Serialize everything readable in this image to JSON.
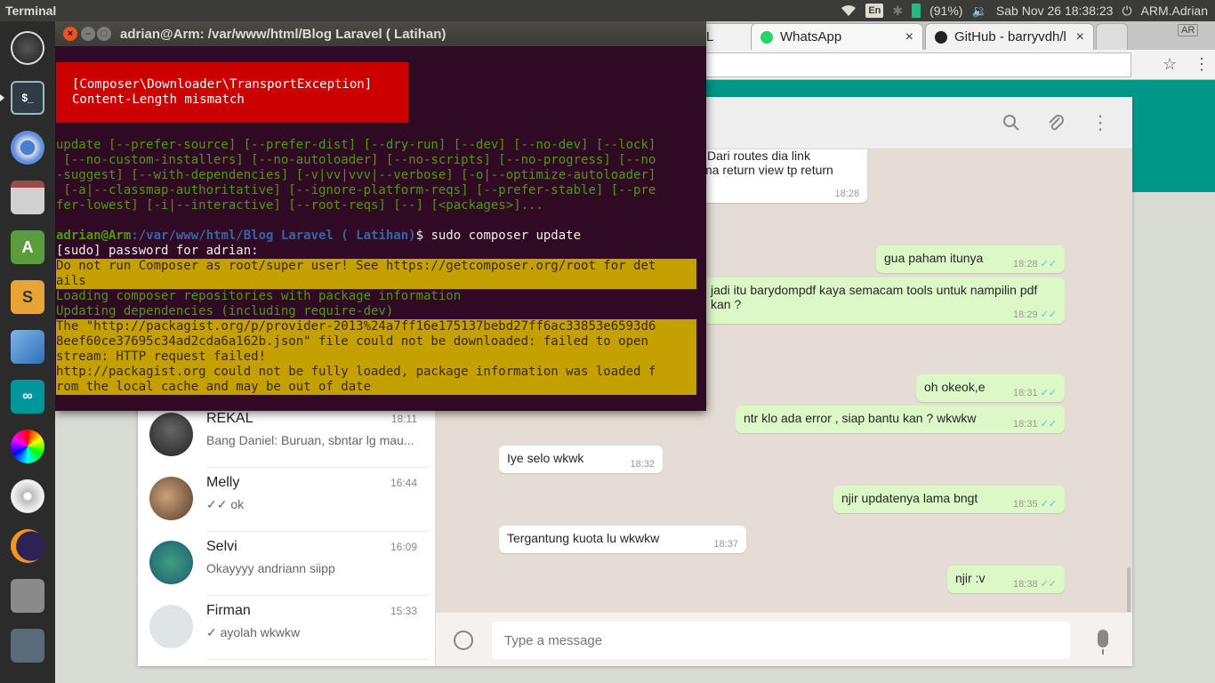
{
  "top_panel": {
    "app_name": "Terminal",
    "battery": "(91%)",
    "keyboard_layout": "En",
    "datetime": "Sab Nov 26 18:38:23",
    "user": "ARM.Adrian"
  },
  "launcher": {
    "items": [
      "ubuntu-dash",
      "terminal",
      "chromium",
      "files",
      "android-studio",
      "sublime-text",
      "virtualbox",
      "arduino",
      "color-picker",
      "disc-burner",
      "eclipse",
      "disk",
      "trash"
    ]
  },
  "browser": {
    "tabs": [
      {
        "label": "RPL",
        "close": "×"
      },
      {
        "label": "WhatsApp",
        "close": "×"
      },
      {
        "label": "GitHub - barryvdh/l",
        "close": "×"
      }
    ],
    "ar_badge": "AR"
  },
  "whatsapp": {
    "chats": [
      {
        "name": "REKAL",
        "time": "18:11",
        "preview": "Bang Daniel: Buruan, sbntar lg mau..."
      },
      {
        "name": "Melly",
        "time": "16:44",
        "preview": "✓✓ ok"
      },
      {
        "name": "Selvi",
        "time": "16:09",
        "preview": "Okayyyy andriann siipp"
      },
      {
        "name": "Firman",
        "time": "15:33",
        "preview": "✓ ayolah wkwkw"
      }
    ],
    "messages": [
      {
        "dir": "in",
        "line1": "Dari routes dia link",
        "line2": "ma return view tp return",
        "time": "18:28"
      },
      {
        "dir": "out",
        "text": "gua paham itunya",
        "time": "18:28",
        "ticks": "✓✓"
      },
      {
        "dir": "out",
        "line1": "jadi itu barydompdf kaya semacam tools untuk nampilin pdf",
        "line2": "kan ?",
        "time": "18:29",
        "ticks": "✓✓"
      },
      {
        "dir": "out",
        "text": "oh okeok,e",
        "time": "18:31",
        "ticks": "✓✓"
      },
      {
        "dir": "out",
        "text": "ntr klo ada error , siap bantu kan ? wkwkw",
        "time": "18:31",
        "ticks": "✓✓"
      },
      {
        "dir": "in",
        "text": "Iye selo wkwk",
        "time": "18:32"
      },
      {
        "dir": "out",
        "text": "njir updatenya lama bngt",
        "time": "18:35",
        "ticks": "✓✓"
      },
      {
        "dir": "in",
        "text": "Tergantung kuota lu wkwkw",
        "time": "18:37"
      },
      {
        "dir": "out",
        "text": "njir :v",
        "time": "18:38",
        "ticks": "✓✓"
      }
    ],
    "input_placeholder": "Type a message"
  },
  "terminal": {
    "title": "adrian@Arm: /var/www/html/Blog Laravel ( Latihan)",
    "error_box": "[Composer\\Downloader\\TransportException]\nContent-Length mismatch",
    "usage": [
      "update [--prefer-source] [--prefer-dist] [--dry-run] [--dev] [--no-dev] [--lock]",
      " [--no-custom-installers] [--no-autoloader] [--no-scripts] [--no-progress] [--no",
      "-suggest] [--with-dependencies] [-v|vv|vvv|--verbose] [-o|--optimize-autoloader]",
      " [-a|--classmap-authoritative] [--ignore-platform-reqs] [--prefer-stable] [--pre",
      "fer-lowest] [-i|--interactive] [--root-reqs] [--] [<packages>]..."
    ],
    "prompt_user": "adrian@Arm",
    "prompt_path": ":/var/www/html/Blog Laravel ( Latihan)",
    "prompt_cmd": "$ sudo composer update",
    "sudo_line": "[sudo] password for adrian:",
    "warn_root": "Do not run Composer as root/super user! See https://getcomposer.org/root for det\nails",
    "loading": "Loading composer repositories with package information",
    "updating": "Updating dependencies (including require-dev)",
    "warn_download": "The \"http://packagist.org/p/provider-2013%24a7ff16e175137bebd27ff6ac33853e6593d6\n8eef60ce37695c34ad2cda6a162b.json\" file could not be downloaded: failed to open\nstream: HTTP request failed!\nhttp://packagist.org could not be fully loaded, package information was loaded f\nrom the local cache and may be out of date"
  }
}
